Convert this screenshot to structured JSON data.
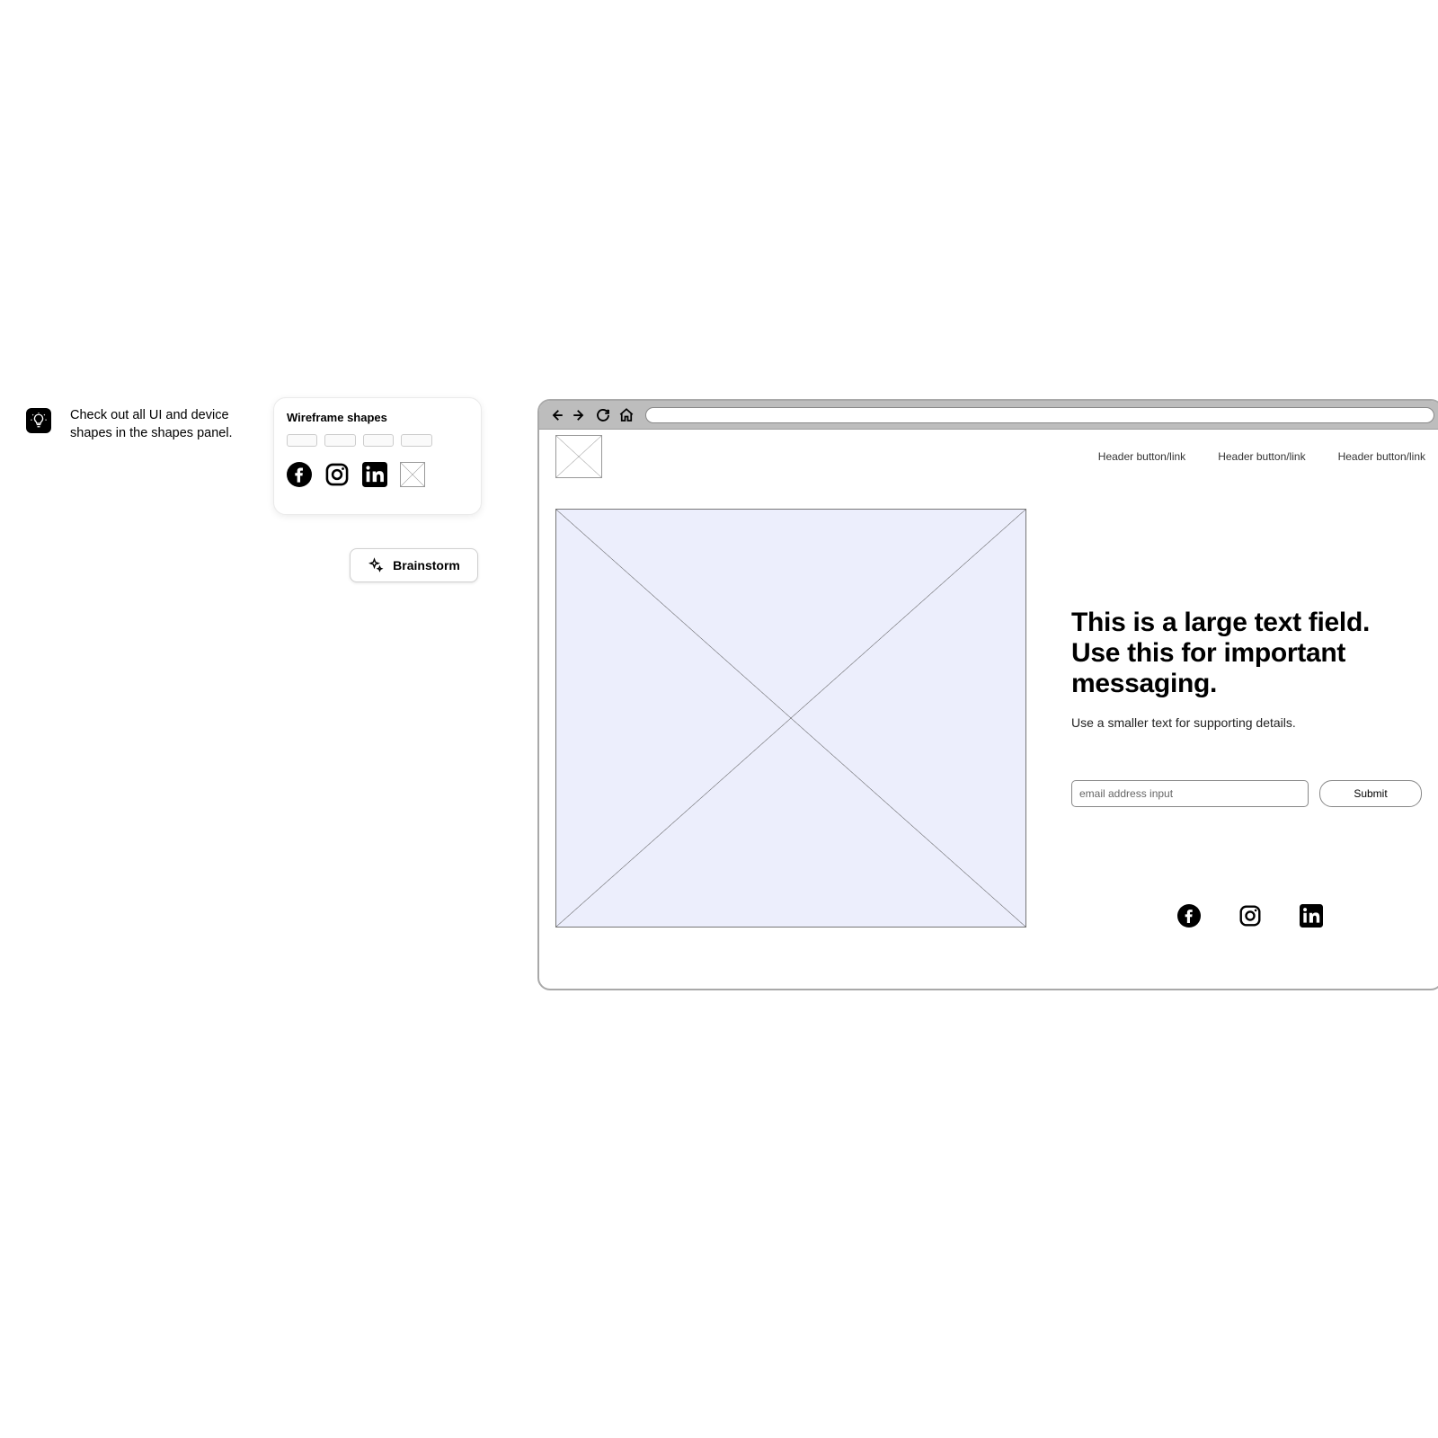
{
  "tip": {
    "text": "Check out all UI and device shapes in the shapes panel.",
    "icon": "lightbulb-icon"
  },
  "wireframe_card": {
    "title": "Wireframe shapes",
    "social_icons": [
      "facebook-icon",
      "instagram-icon",
      "linkedin-icon",
      "image-placeholder-icon"
    ]
  },
  "brainstorm": {
    "label": "Brainstorm",
    "icon": "sparkle-icon"
  },
  "browser": {
    "nav_icons": [
      "back-icon",
      "forward-icon",
      "reload-icon",
      "home-icon"
    ]
  },
  "page": {
    "header_links": [
      "Header button/link",
      "Header button/link",
      "Header button/link"
    ],
    "hero": {
      "headline": "This is a large text field. Use this for important messaging.",
      "subtext": "Use a smaller text for supporting details.",
      "email_placeholder": "email address input",
      "submit_label": "Submit"
    },
    "socials": [
      "facebook-icon",
      "instagram-icon",
      "linkedin-icon"
    ]
  }
}
